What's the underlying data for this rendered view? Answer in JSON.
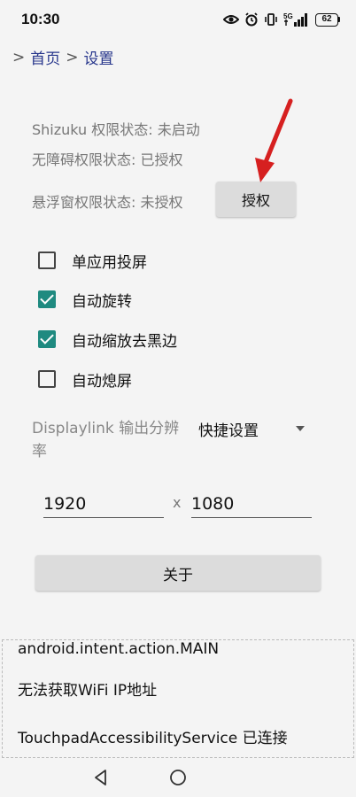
{
  "status_bar": {
    "time": "10:30",
    "network": "5G",
    "battery": "62",
    "icons": [
      "eye-comfort-icon",
      "alarm-icon",
      "vibrate-icon",
      "signal-icon",
      "battery-icon"
    ]
  },
  "breadcrumb": {
    "sep1": ">",
    "home": "首页",
    "sep2": ">",
    "current": "设置"
  },
  "permissions": {
    "shizuku": "Shizuku 权限状态: 未启动",
    "accessibility": "无障碍权限状态: 已授权",
    "overlay": "悬浮窗权限状态: 未授权",
    "grant_button": "授权"
  },
  "options": [
    {
      "label": "单应用投屏",
      "checked": false
    },
    {
      "label": "自动旋转",
      "checked": true
    },
    {
      "label": "自动缩放去黑边",
      "checked": true
    },
    {
      "label": "自动熄屏",
      "checked": false
    }
  ],
  "displaylink": {
    "label": "Displaylink 输出分辨率",
    "selected": "快捷设置"
  },
  "resolution": {
    "width": "1920",
    "separator": "x",
    "height": "1080"
  },
  "about_button": "关于",
  "log": [
    "android.intent.action.MAIN",
    "无法获取WiFi IP地址",
    "TouchpadAccessibilityService 已连接"
  ],
  "colors": {
    "accent": "#1f8a80",
    "link": "#27368c",
    "annotation_arrow": "#d62020"
  }
}
